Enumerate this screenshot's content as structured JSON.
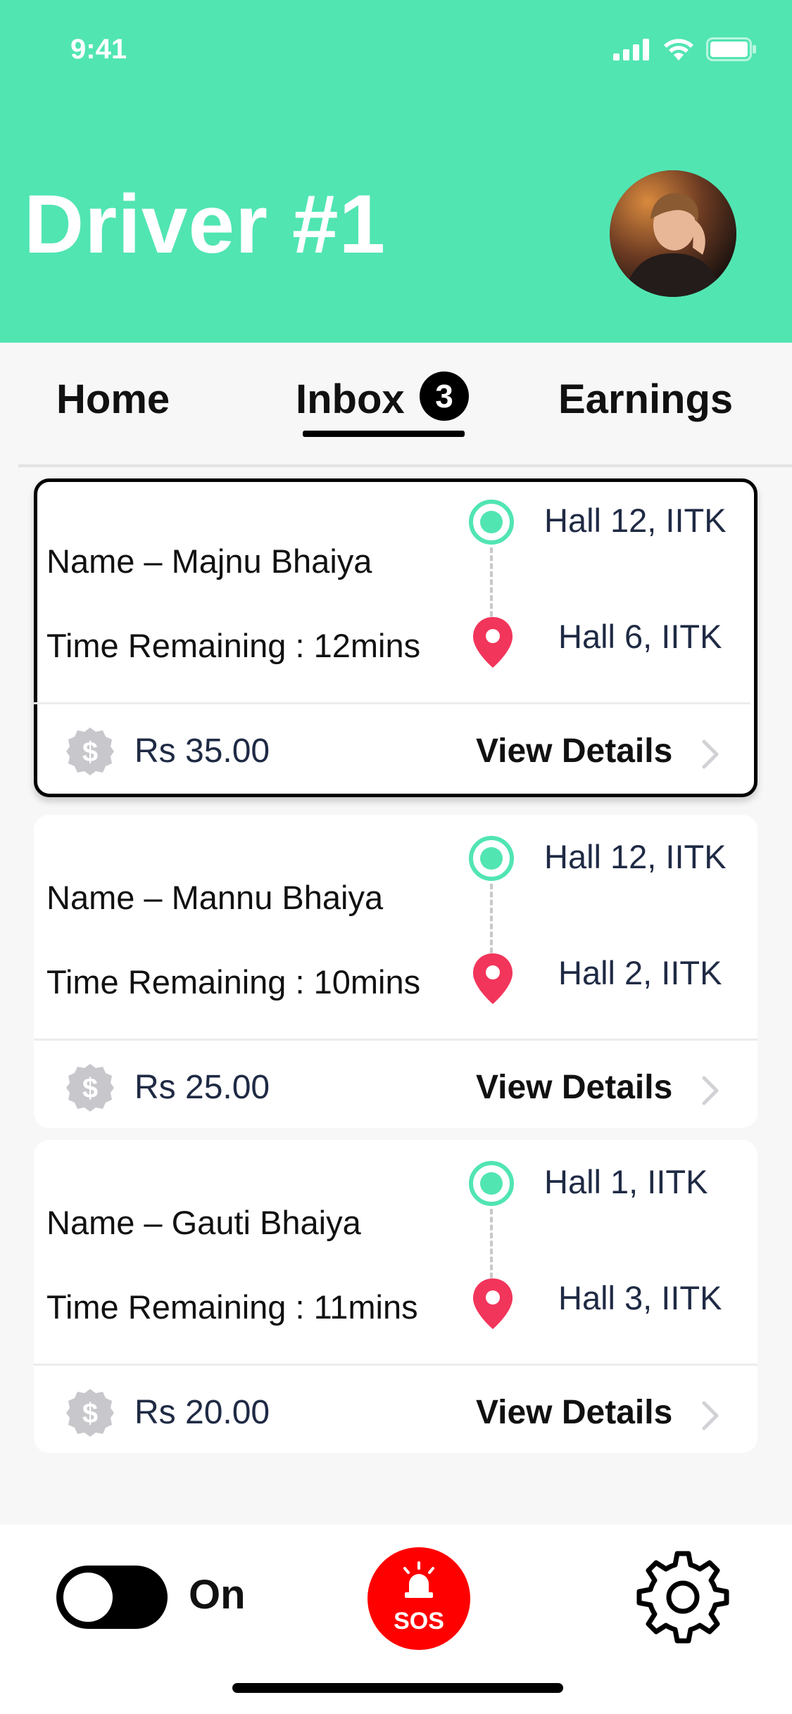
{
  "status_bar": {
    "time": "9:41"
  },
  "header": {
    "title": "Driver #1"
  },
  "tabs": [
    {
      "label": "Home"
    },
    {
      "label": "Inbox",
      "badge": "3",
      "active": true
    },
    {
      "label": "Earnings"
    }
  ],
  "rides": [
    {
      "name": "Name – Majnu Bhaiya",
      "time": "Time Remaining : 12mins",
      "from": "Hall 12, IITK",
      "to": "Hall 6, IITK",
      "price": "Rs 35.00",
      "view": "View Details",
      "selected": true
    },
    {
      "name": "Name – Mannu Bhaiya",
      "time": "Time Remaining : 10mins",
      "from": "Hall 12, IITK",
      "to": "Hall 2, IITK",
      "price": "Rs 25.00",
      "view": "View Details",
      "selected": false
    },
    {
      "name": "Name – Gauti Bhaiya",
      "time": "Time Remaining : 11mins",
      "from": "Hall 1, IITK",
      "to": "Hall 3, IITK",
      "price": "Rs 20.00",
      "view": "View Details",
      "selected": false
    }
  ],
  "bottom_bar": {
    "toggle_label": "On",
    "toggle_on": false,
    "sos_label": "SOS"
  },
  "colors": {
    "accent": "#51e5b2",
    "pin": "#f2355b",
    "sos": "#ff0000",
    "text_dark": "#1f2a44"
  },
  "icons": {
    "signal": "signal-icon",
    "wifi": "wifi-icon",
    "battery": "battery-icon",
    "coin": "dollar-coin-icon",
    "chevron": "chevron-right-icon",
    "pin": "location-pin-icon",
    "settings": "gear-icon",
    "sos": "siren-icon"
  }
}
